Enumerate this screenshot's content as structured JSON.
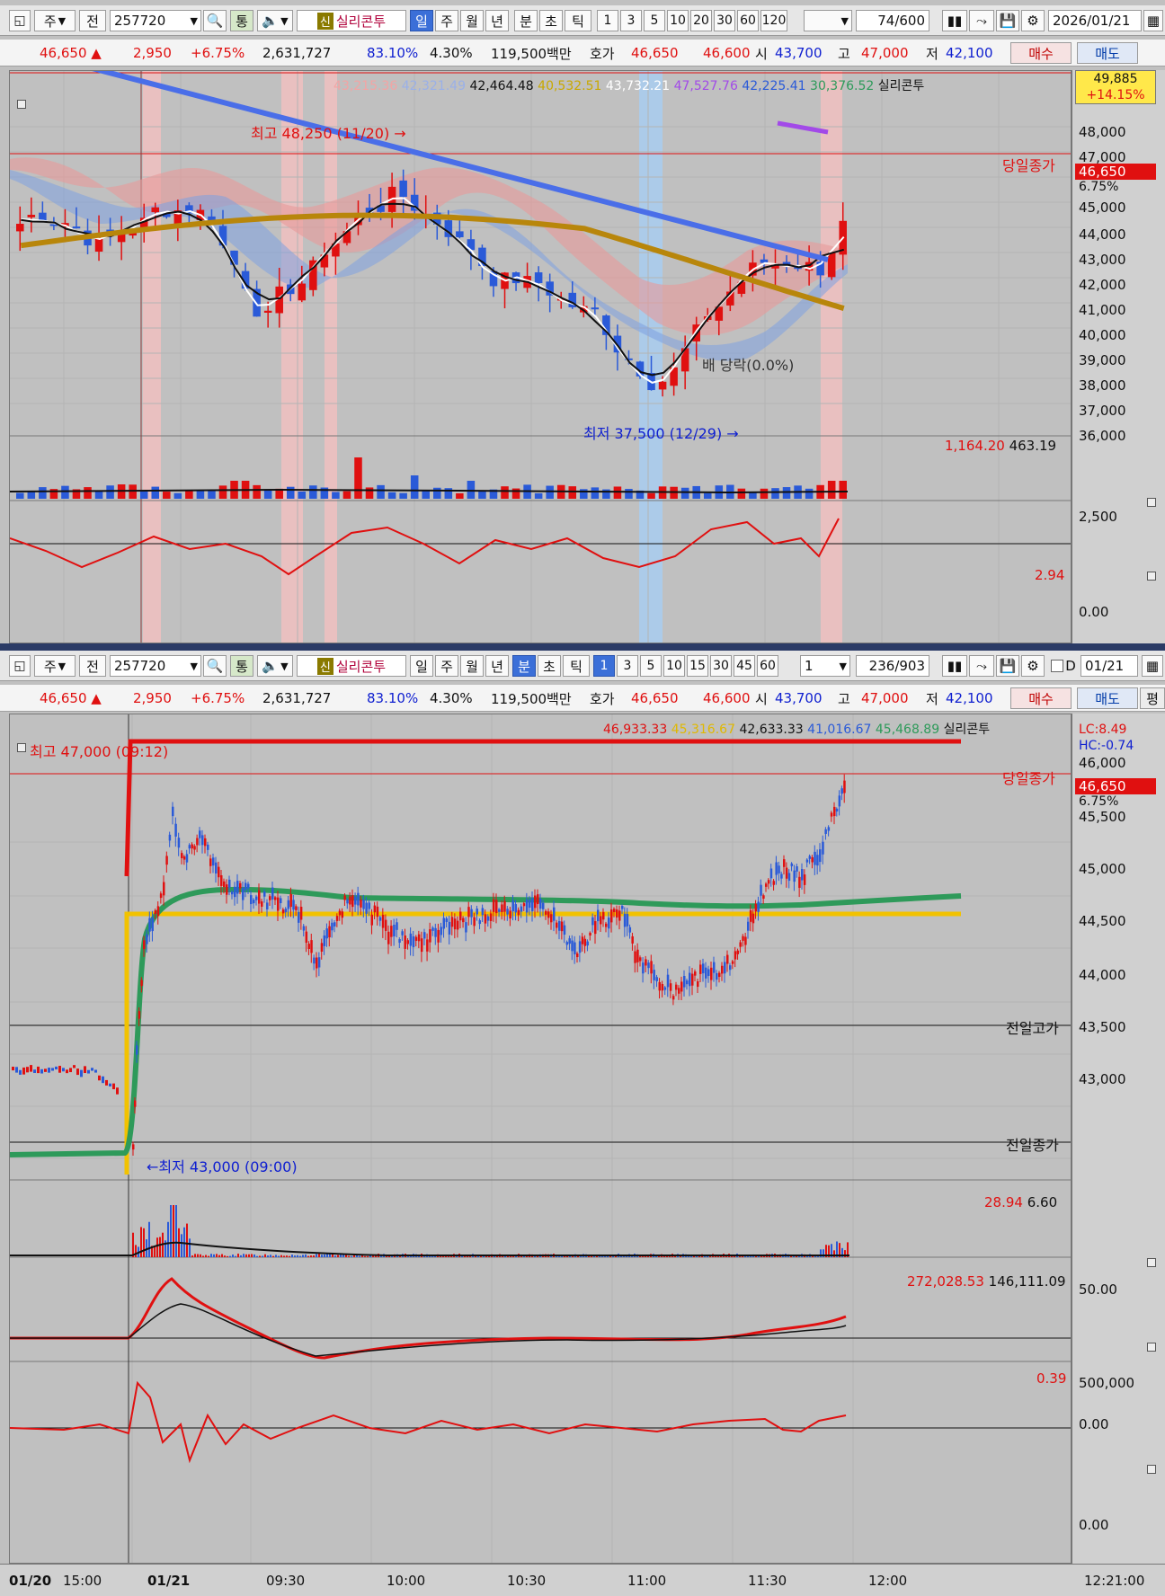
{
  "top": {
    "toolbar": {
      "type_sel": "주",
      "all_label": "전",
      "code": "257720",
      "tong": "통",
      "brand_badge": "신",
      "brand": "실리콘투",
      "periods": [
        "일",
        "주",
        "월",
        "년",
        "분",
        "초",
        "틱"
      ],
      "period_active": 0,
      "nums": [
        "1",
        "3",
        "5",
        "10",
        "20",
        "30",
        "60",
        "120"
      ],
      "count": "74",
      "count_total": "/600",
      "date": "2026/01/21"
    },
    "info": {
      "price": "46,650",
      "change": "2,950",
      "change_pct": "+6.75%",
      "volume": "2,631,727",
      "ratio1": "83.10%",
      "ratio2": "4.30%",
      "amount": "119,500백만",
      "hoga_label": "호가",
      "ask": "46,650",
      "bid": "46,600",
      "open_label": "시",
      "open": "43,700",
      "high_label": "고",
      "high": "47,000",
      "low_label": "저",
      "low": "42,100",
      "buy": "매수",
      "sell": "매도"
    },
    "legend": [
      "43,215.36",
      "42,321.49",
      "42,464.48",
      "40,532.51",
      "43,732.21",
      "47,527.76",
      "42,225.41",
      "30,376.52"
    ],
    "legend_name": "실리콘투",
    "yaxis": [
      "48,000",
      "47,000",
      "45,000",
      "44,000",
      "43,000",
      "42,000",
      "41,000",
      "40,000",
      "39,000",
      "38,000",
      "37,000",
      "36,000"
    ],
    "tag_price": "49,885",
    "tag_pct": "+14.15%",
    "close_label": "당일종가",
    "close_price": "46,650",
    "close_pct": "6.75%",
    "high_ann": "최고 48,250 (11/20) →",
    "low_ann": "최저 37,500 (12/29) →",
    "mid_ann": "배 당락(0.0%)",
    "vol_legend1": "1,164.20",
    "vol_legend2": "463.19",
    "vol_axis": "2,500",
    "osc_value": "2.94",
    "osc_zero": "0.00"
  },
  "bottom": {
    "toolbar": {
      "type_sel": "주",
      "all_label": "전",
      "code": "257720",
      "tong": "통",
      "brand_badge": "신",
      "brand": "실리콘투",
      "periods": [
        "일",
        "주",
        "월",
        "년",
        "분",
        "초",
        "틱"
      ],
      "period_active": 4,
      "nums": [
        "1",
        "3",
        "5",
        "10",
        "15",
        "30",
        "45",
        "60"
      ],
      "num_active": 0,
      "interval": "1",
      "count": "236",
      "count_total": "/903",
      "d_label": "D",
      "date": "01/21"
    },
    "info": {
      "price": "46,650",
      "change": "2,950",
      "change_pct": "+6.75%",
      "volume": "2,631,727",
      "ratio1": "83.10%",
      "ratio2": "4.30%",
      "amount": "119,500백만",
      "hoga_label": "호가",
      "ask": "46,650",
      "bid": "46,600",
      "open_label": "시",
      "open": "43,700",
      "high_label": "고",
      "high": "47,000",
      "low_label": "저",
      "low": "42,100",
      "buy": "매수",
      "sell": "매도",
      "extra": "평"
    },
    "legend": [
      "46,933.33",
      "45,316.67",
      "42,633.33",
      "41,016.67",
      "45,468.89"
    ],
    "legend_name": "실리콘투",
    "lc": "LC:8.49",
    "hc": "HC:-0.74",
    "yaxis": [
      "46,000",
      "45,500",
      "45,000",
      "44,500",
      "44,000",
      "43,500",
      "43,000"
    ],
    "close_label": "당일종가",
    "close_price": "46,650",
    "close_pct": "6.75%",
    "prev_high": "전일고가",
    "prev_close": "전일종가",
    "high_ann": "최고 47,000 (09:12)",
    "low_ann": "←최저 43,000 (09:00)",
    "vol_legend1": "28.94",
    "vol_legend2": "6.60",
    "vol_axis": "50.00",
    "obv_legend1": "272,028.53",
    "obv_legend2": "146,111.09",
    "obv_axis1": "500,000",
    "obv_axis2": "0.00",
    "osc_value": "0.39",
    "osc_zero": "0.00",
    "xaxis": [
      "01/20",
      "15:00",
      "01/21",
      "09:30",
      "10:00",
      "10:30",
      "11:00",
      "11:30",
      "12:00",
      "12:21:00"
    ]
  },
  "colors": {
    "up": "#e01010",
    "down": "#2a5ad8",
    "ma_gold": "#b8860b",
    "ma_blue": "#4a6ee8",
    "ma_green": "#2e9a5a",
    "ma_yellow": "#f2c200"
  }
}
